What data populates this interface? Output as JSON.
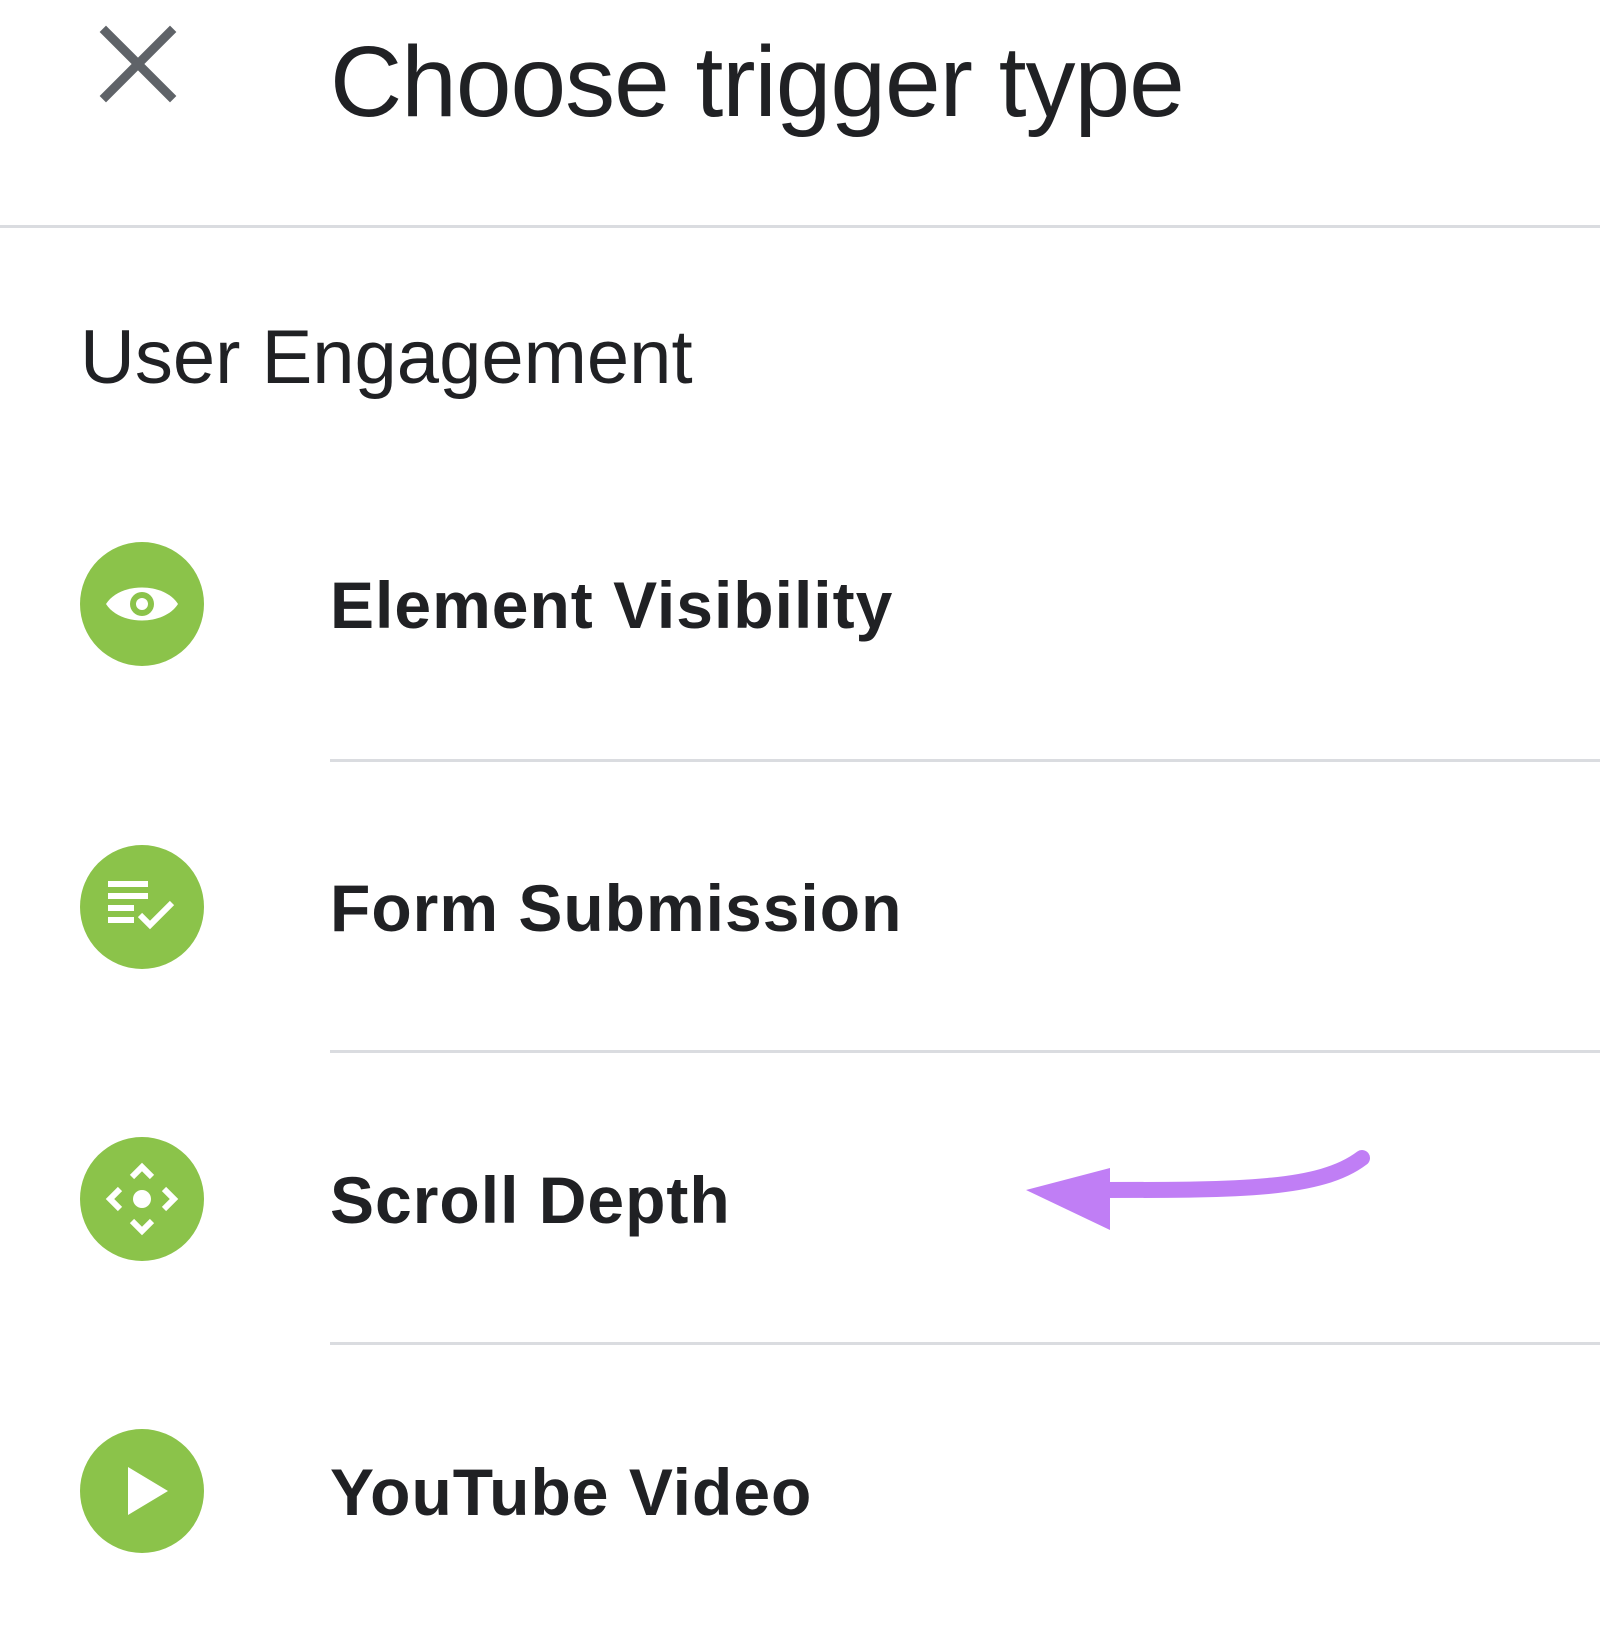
{
  "dialog": {
    "title": "Choose trigger type",
    "close_icon": "close-icon"
  },
  "section": {
    "title": "User Engagement"
  },
  "items": [
    {
      "label": "Element Visibility",
      "icon": "eye-icon"
    },
    {
      "label": "Form Submission",
      "icon": "checklist-icon"
    },
    {
      "label": "Scroll Depth",
      "icon": "scroll-arrows-icon"
    },
    {
      "label": "YouTube Video",
      "icon": "play-icon"
    }
  ],
  "colors": {
    "icon_background": "#8bc34a",
    "annotation_arrow": "#c07ef5",
    "divider": "#dadce0",
    "text": "#202124"
  }
}
